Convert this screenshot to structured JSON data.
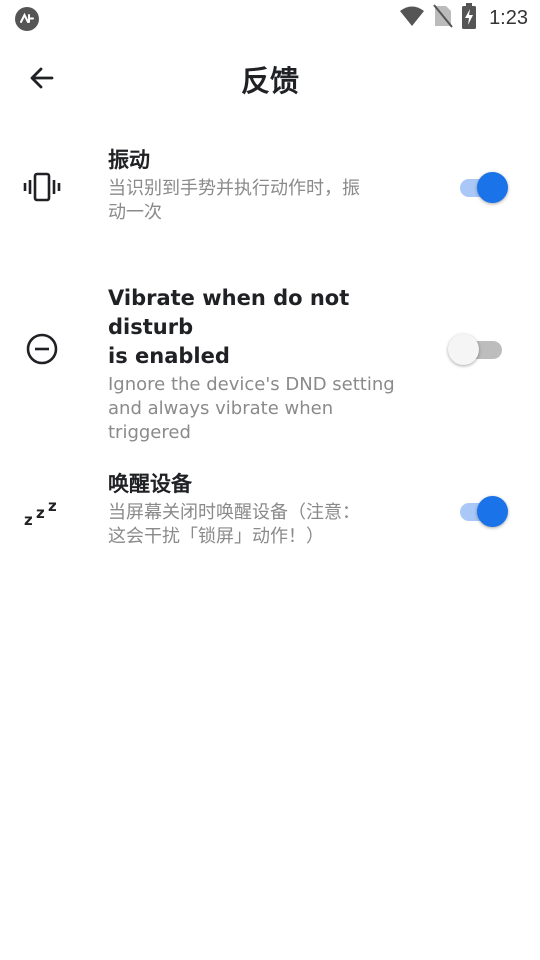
{
  "status_bar": {
    "time": "1:23",
    "icons": [
      "app-logo-icon",
      "wifi-icon",
      "no-sim-icon",
      "battery-charging-icon"
    ]
  },
  "app_bar": {
    "title": "反馈",
    "back_icon": "arrow-left-icon"
  },
  "settings": [
    {
      "icon": "vibration-icon",
      "title": "振动",
      "summary_lines": [
        "当识别到手势并执行动作时，振",
        "动一次"
      ],
      "enabled": true
    },
    {
      "icon": "do-not-disturb-icon",
      "title_lines": [
        "Vibrate when do not disturb",
        "is enabled"
      ],
      "summary_lines": [
        "Ignore the device's DND setting",
        "and always vibrate when",
        "triggered"
      ],
      "enabled": false
    },
    {
      "icon": "sleep-zzz-icon",
      "title": "唤醒设备",
      "summary_lines": [
        "当屏幕关闭时唤醒设备（注意：",
        "这会干扰「锁屏」动作！）"
      ],
      "enabled": true
    }
  ],
  "colors": {
    "accent": "#1a73e8",
    "accent_track": "#a9c8f7",
    "off_thumb": "#f5f5f5",
    "off_track": "#bdbdbd",
    "summary_text": "#8a8a8a"
  }
}
